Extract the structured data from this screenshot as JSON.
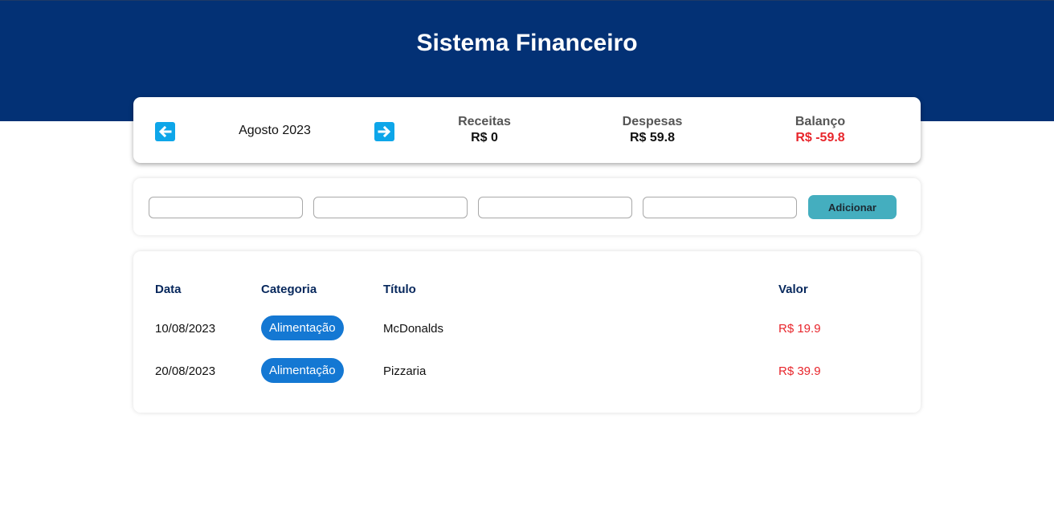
{
  "header": {
    "title": "Sistema Financeiro"
  },
  "info": {
    "month": "Agosto 2023",
    "receitas": {
      "label": "Receitas",
      "value": "R$ 0"
    },
    "despesas": {
      "label": "Despesas",
      "value": "R$ 59.8"
    },
    "balanco": {
      "label": "Balanço",
      "value": "R$ -59.8"
    }
  },
  "form": {
    "inputs": [
      "",
      "",
      "",
      ""
    ],
    "add_label": "Adicionar"
  },
  "table": {
    "headers": [
      "Data",
      "Categoria",
      "Título",
      "Valor"
    ],
    "rows": [
      {
        "date": "10/08/2023",
        "category": "Alimentação",
        "title": "McDonalds",
        "value": "R$ 19.9"
      },
      {
        "date": "20/08/2023",
        "category": "Alimentação",
        "title": "Pizzaria",
        "value": "R$ 39.9"
      }
    ]
  },
  "colors": {
    "header_bg": "#033175",
    "arrow_bg": "#0ea6e9",
    "negative": "#e8262c",
    "category_pill": "#1478d3",
    "add_button": "#44aebf"
  },
  "icons": {
    "prev": "arrow-left-icon",
    "next": "arrow-right-icon"
  }
}
